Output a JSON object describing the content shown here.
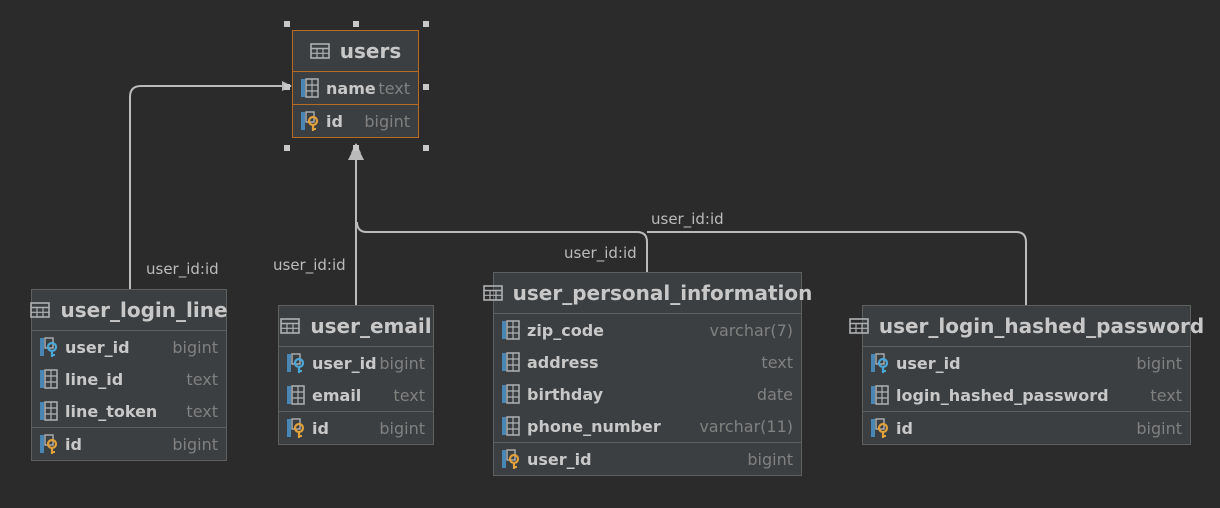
{
  "colors": {
    "background": "#2b2b2b",
    "table_bg": "#3c3f41",
    "selection": "#b86b25",
    "text": "#c8c8c8",
    "type_text": "#808080",
    "link": "#bbbbbb",
    "pk_key": "#e0a03b",
    "fk_key": "#4aa8d8"
  },
  "tables": {
    "users": {
      "title": "users",
      "columns": [
        {
          "name": "name",
          "type": "text",
          "icon": "column-icon"
        },
        {
          "name": "id",
          "type": "bigint",
          "icon": "primary-key-icon"
        }
      ]
    },
    "user_login_line": {
      "title": "user_login_line",
      "columns": [
        {
          "name": "user_id",
          "type": "bigint",
          "icon": "foreign-key-icon"
        },
        {
          "name": "line_id",
          "type": "text",
          "icon": "column-icon"
        },
        {
          "name": "line_token",
          "type": "text",
          "icon": "column-icon"
        },
        {
          "name": "id",
          "type": "bigint",
          "icon": "primary-key-icon"
        }
      ]
    },
    "user_email": {
      "title": "user_email",
      "columns": [
        {
          "name": "user_id",
          "type": "bigint",
          "icon": "foreign-key-icon"
        },
        {
          "name": "email",
          "type": "text",
          "icon": "column-icon"
        },
        {
          "name": "id",
          "type": "bigint",
          "icon": "primary-key-icon"
        }
      ]
    },
    "user_personal_information": {
      "title": "user_personal_information",
      "columns": [
        {
          "name": "zip_code",
          "type": "varchar(7)",
          "icon": "column-icon"
        },
        {
          "name": "address",
          "type": "text",
          "icon": "column-icon"
        },
        {
          "name": "birthday",
          "type": "date",
          "icon": "column-icon"
        },
        {
          "name": "phone_number",
          "type": "varchar(11)",
          "icon": "column-icon"
        },
        {
          "name": "user_id",
          "type": "bigint",
          "icon": "primary-foreign-key-icon"
        }
      ]
    },
    "user_login_hashed_password": {
      "title": "user_login_hashed_password",
      "columns": [
        {
          "name": "user_id",
          "type": "bigint",
          "icon": "foreign-key-icon"
        },
        {
          "name": "login_hashed_password",
          "type": "text",
          "icon": "column-icon"
        },
        {
          "name": "id",
          "type": "bigint",
          "icon": "primary-key-icon"
        }
      ]
    }
  },
  "relations": [
    {
      "from": "user_login_line",
      "to": "users",
      "label": "user_id:id"
    },
    {
      "from": "user_email",
      "to": "users",
      "label": "user_id:id"
    },
    {
      "from": "user_personal_information",
      "to": "users",
      "label": "user_id:id"
    },
    {
      "from": "user_login_hashed_password",
      "to": "users",
      "label": "user_id:id"
    }
  ]
}
